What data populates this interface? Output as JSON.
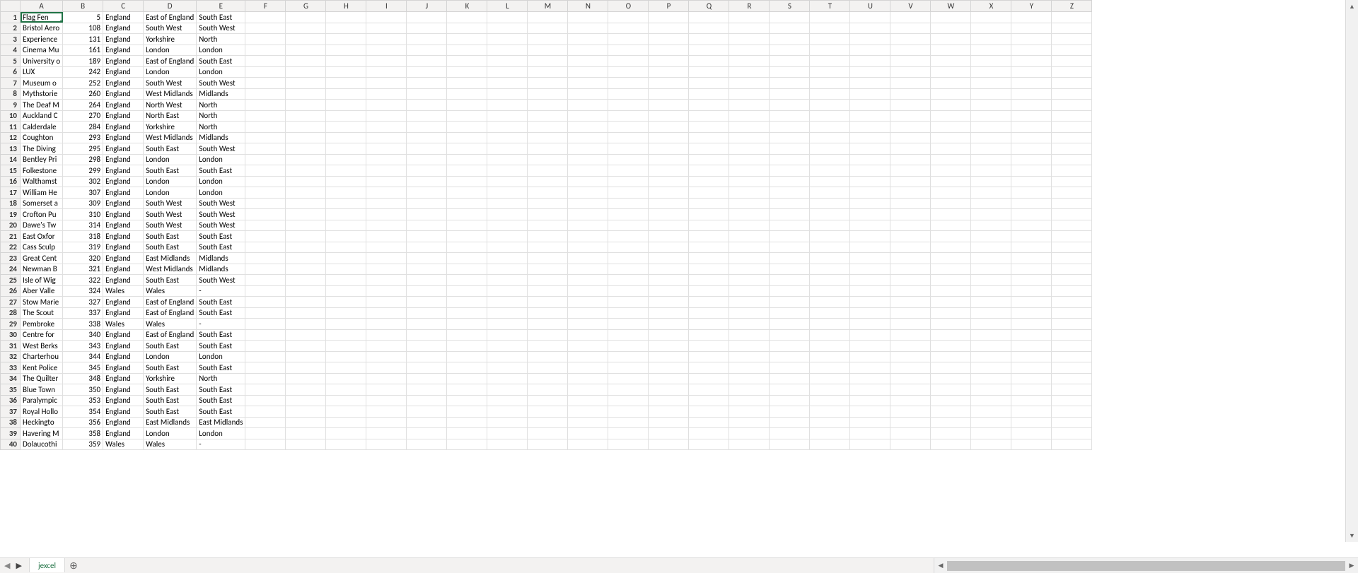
{
  "columns": [
    "A",
    "B",
    "C",
    "D",
    "E",
    "F",
    "G",
    "H",
    "I",
    "J",
    "K",
    "L",
    "M",
    "N",
    "O",
    "P",
    "Q",
    "R",
    "S",
    "T",
    "U",
    "V",
    "W",
    "X",
    "Y",
    "Z"
  ],
  "col_widths": {
    "default": 57,
    "A": 57,
    "B": 57,
    "C": 57,
    "D": 57,
    "E": 57
  },
  "visible_row_count": 40,
  "selected": {
    "row": 1,
    "col": "A"
  },
  "tabs": [
    {
      "label": "jexcel"
    }
  ],
  "rows": [
    {
      "A": "Flag Fen",
      "B": 5,
      "C": "England",
      "D": "East of England",
      "E": "South East"
    },
    {
      "A": "Bristol Aero",
      "B": 108,
      "C": "England",
      "D": "South West",
      "E": "South West"
    },
    {
      "A": "Experience",
      "B": 131,
      "C": "England",
      "D": "Yorkshire",
      "E": "North"
    },
    {
      "A": "Cinema Mu",
      "B": 161,
      "C": "England",
      "D": "London",
      "E": "London"
    },
    {
      "A": "University o",
      "B": 189,
      "C": "England",
      "D": "East of England",
      "E": "South East"
    },
    {
      "A": "LUX",
      "B": 242,
      "C": "England",
      "D": "London",
      "E": "London"
    },
    {
      "A": "Museum o",
      "B": 252,
      "C": "England",
      "D": "South West",
      "E": "South West"
    },
    {
      "A": "Mythstorie",
      "B": 260,
      "C": "England",
      "D": "West Midlands",
      "E": "Midlands"
    },
    {
      "A": "The Deaf M",
      "B": 264,
      "C": "England",
      "D": "North West",
      "E": "North"
    },
    {
      "A": "Auckland C",
      "B": 270,
      "C": "England",
      "D": "North East",
      "E": "North"
    },
    {
      "A": "Calderdale",
      "B": 284,
      "C": "England",
      "D": "Yorkshire",
      "E": "North"
    },
    {
      "A": "Coughton",
      "B": 293,
      "C": "England",
      "D": "West Midlands",
      "E": "Midlands"
    },
    {
      "A": "The Diving",
      "B": 295,
      "C": "England",
      "D": "South East",
      "E": "South West"
    },
    {
      "A": "Bentley Pri",
      "B": 298,
      "C": "England",
      "D": "London",
      "E": "London"
    },
    {
      "A": "Folkestone",
      "B": 299,
      "C": "England",
      "D": "South East",
      "E": "South East"
    },
    {
      "A": "Walthamst",
      "B": 302,
      "C": "England",
      "D": "London",
      "E": "London"
    },
    {
      "A": "William He",
      "B": 307,
      "C": "England",
      "D": "London",
      "E": "London"
    },
    {
      "A": "Somerset a",
      "B": 309,
      "C": "England",
      "D": "South West",
      "E": "South West"
    },
    {
      "A": "Crofton Pu",
      "B": 310,
      "C": "England",
      "D": "South West",
      "E": "South West"
    },
    {
      "A": "Dawe's Tw",
      "B": 314,
      "C": "England",
      "D": "South West",
      "E": "South West"
    },
    {
      "A": "East Oxfor",
      "B": 318,
      "C": "England",
      "D": "South East",
      "E": "South East"
    },
    {
      "A": "Cass Sculp",
      "B": 319,
      "C": "England",
      "D": "South East",
      "E": "South East"
    },
    {
      "A": "Great Cent",
      "B": 320,
      "C": "England",
      "D": "East Midlands",
      "E": "Midlands"
    },
    {
      "A": "Newman B",
      "B": 321,
      "C": "England",
      "D": "West Midlands",
      "E": "Midlands"
    },
    {
      "A": "Isle of Wig",
      "B": 322,
      "C": "England",
      "D": "South East",
      "E": "South West"
    },
    {
      "A": "Aber Valle",
      "B": 324,
      "C": "Wales",
      "D": "Wales",
      "E": "-"
    },
    {
      "A": "Stow Marie",
      "B": 327,
      "C": "England",
      "D": "East of England",
      "E": "South East"
    },
    {
      "A": "The Scout",
      "B": 337,
      "C": "England",
      "D": "East of England",
      "E": "South East"
    },
    {
      "A": "Pembroke",
      "B": 338,
      "C": "Wales",
      "D": "Wales",
      "E": "-"
    },
    {
      "A": "Centre for",
      "B": 340,
      "C": "England",
      "D": "East of England",
      "E": "South East"
    },
    {
      "A": "West Berks",
      "B": 343,
      "C": "England",
      "D": "South East",
      "E": "South East"
    },
    {
      "A": "Charterhou",
      "B": 344,
      "C": "England",
      "D": "London",
      "E": "London"
    },
    {
      "A": "Kent Police",
      "B": 345,
      "C": "England",
      "D": "South East",
      "E": "South East"
    },
    {
      "A": "The Quilter",
      "B": 348,
      "C": "England",
      "D": "Yorkshire",
      "E": "North"
    },
    {
      "A": "Blue Town",
      "B": 350,
      "C": "England",
      "D": "South East",
      "E": "South East"
    },
    {
      "A": "Paralympic",
      "B": 353,
      "C": "England",
      "D": "South East",
      "E": "South East"
    },
    {
      "A": "Royal Hollo",
      "B": 354,
      "C": "England",
      "D": "South East",
      "E": "South East"
    },
    {
      "A": "Heckingto",
      "B": 356,
      "C": "England",
      "D": "East Midlands",
      "E": "East Midlands"
    },
    {
      "A": "Havering M",
      "B": 358,
      "C": "England",
      "D": "London",
      "E": "London"
    },
    {
      "A": "Dolaucothi",
      "B": 359,
      "C": "Wales",
      "D": "Wales",
      "E": "-"
    }
  ]
}
